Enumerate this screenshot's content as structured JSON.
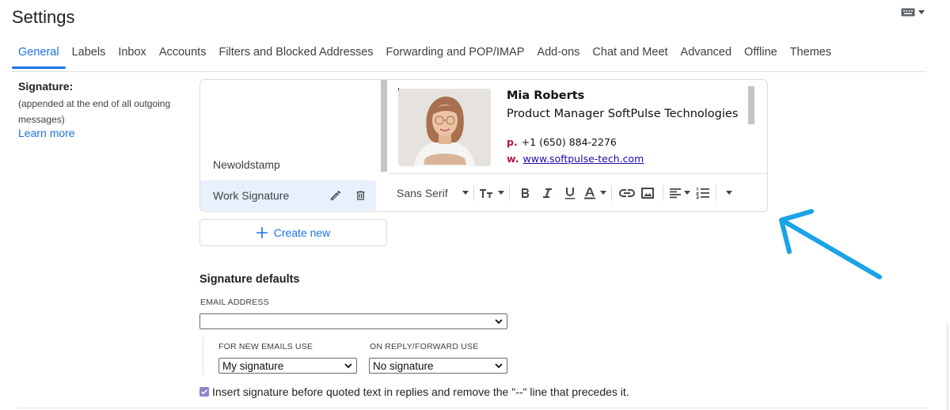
{
  "header": {
    "title": "Settings",
    "keyboard_icon": "keyboard-icon"
  },
  "tabs": [
    {
      "label": "General",
      "active": true
    },
    {
      "label": "Labels"
    },
    {
      "label": "Inbox"
    },
    {
      "label": "Accounts"
    },
    {
      "label": "Filters and Blocked Addresses"
    },
    {
      "label": "Forwarding and POP/IMAP"
    },
    {
      "label": "Add-ons"
    },
    {
      "label": "Chat and Meet"
    },
    {
      "label": "Advanced"
    },
    {
      "label": "Offline"
    },
    {
      "label": "Themes"
    }
  ],
  "signature": {
    "heading": "Signature:",
    "description": "(appended at the end of all outgoing messages)",
    "learn_more": "Learn more",
    "items": [
      "Newoldstamp",
      "Work Signature"
    ],
    "selected_item": "Work Signature",
    "create_new": "Create new",
    "preview": {
      "name": "Mia Roberts",
      "title": "Product Manager SoftPulse Technologies",
      "phone_label": "p.",
      "phone": "+1 (650) 884-2276",
      "web_label": "w.",
      "web": "www.softpulse-tech.com"
    },
    "toolbar": {
      "font": "Sans Serif"
    }
  },
  "defaults": {
    "heading": "Signature defaults",
    "email_label": "EMAIL ADDRESS",
    "email_value": "",
    "new_label": "FOR NEW EMAILS USE",
    "new_value": "My signature",
    "reply_label": "ON REPLY/FORWARD USE",
    "reply_value": "No signature",
    "insert_text": "Insert signature before quoted text in replies and remove the \"--\" line that precedes it.",
    "insert_checked": true
  },
  "colors": {
    "accent": "#1a73e8",
    "selected_bg": "#e8f0fe",
    "arrow": "#1aa3e8",
    "label_red": "#b0154f"
  }
}
